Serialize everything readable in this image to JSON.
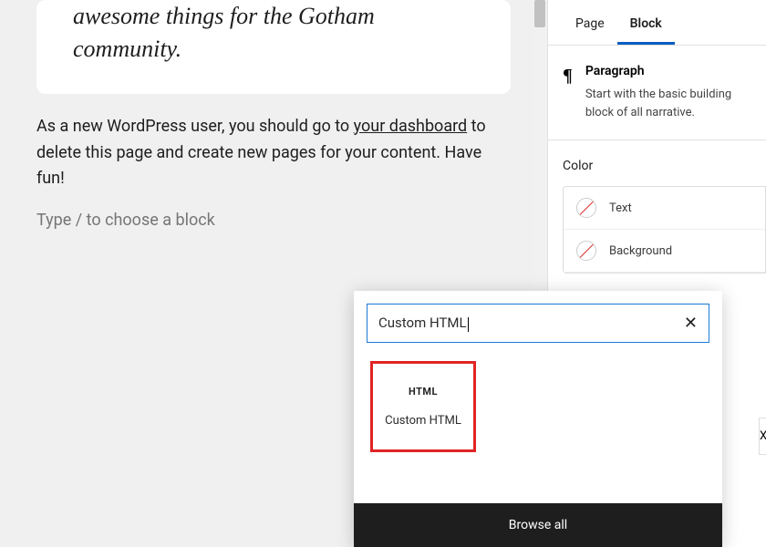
{
  "editor": {
    "quote": "awesome things for the Gotham community.",
    "paragraph_before": "As a new WordPress user, you should go to ",
    "paragraph_link": "your dashboard",
    "paragraph_after": " to delete this page and create new pages for your content. Have fun!",
    "placeholder": "Type / to choose a block"
  },
  "inserter": {
    "search_value": "Custom HTML",
    "result_icon_label": "HTML",
    "result_label": "Custom HTML",
    "browse_all": "Browse all"
  },
  "sidebar": {
    "tabs": {
      "page": "Page",
      "block": "Block"
    },
    "block_title": "Paragraph",
    "block_desc": "Start with the basic building block of all narrative.",
    "color": {
      "heading": "Color",
      "text": "Text",
      "background": "Background"
    },
    "size_stub": "Xl"
  }
}
